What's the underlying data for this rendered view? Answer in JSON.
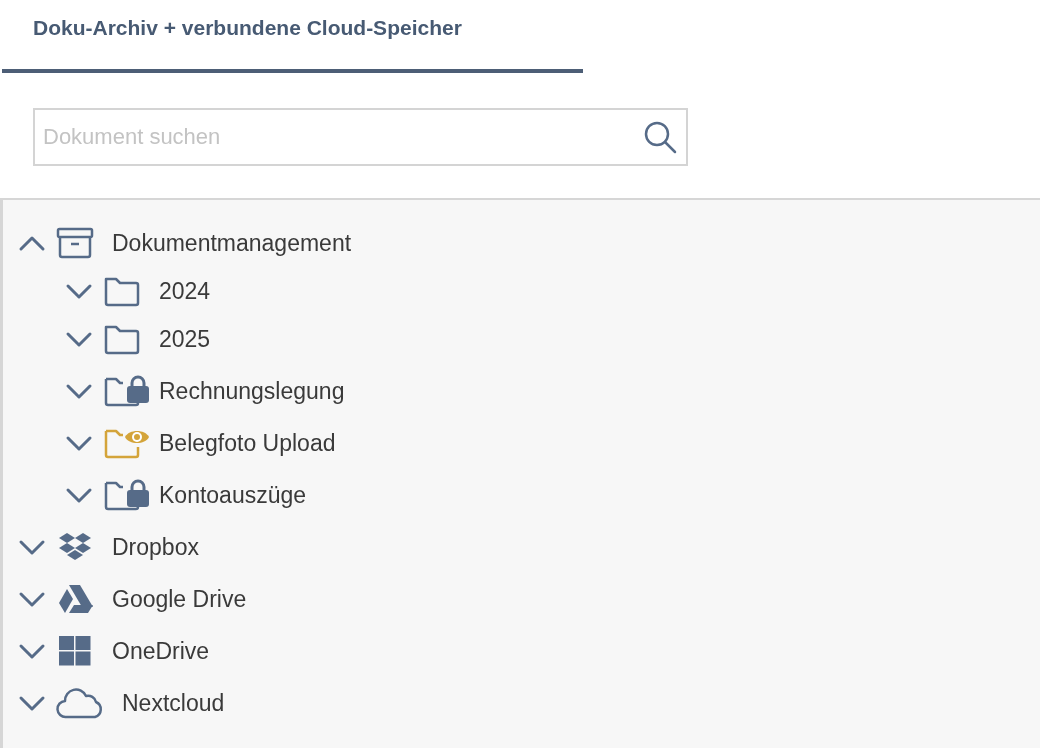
{
  "tab": {
    "label": "Doku-Archiv + verbundene Cloud-Speicher",
    "selected": true
  },
  "search": {
    "placeholder": "Dokument suchen"
  },
  "tree": [
    {
      "label": "Dokumentmanagement",
      "kind": "archive",
      "expanded": true,
      "children": [
        {
          "label": "2024",
          "kind": "folder",
          "expanded": false
        },
        {
          "label": "2025",
          "kind": "folder",
          "expanded": false
        },
        {
          "label": "Rechnungslegung",
          "kind": "locked-folder",
          "expanded": false
        },
        {
          "label": "Belegfoto Upload",
          "kind": "watched-folder",
          "expanded": false
        },
        {
          "label": "Kontoauszüge",
          "kind": "locked-folder",
          "expanded": false
        }
      ]
    },
    {
      "label": "Dropbox",
      "kind": "dropbox",
      "expanded": false
    },
    {
      "label": "Google Drive",
      "kind": "drive",
      "expanded": false
    },
    {
      "label": "OneDrive",
      "kind": "windows",
      "expanded": false
    },
    {
      "label": "Nextcloud",
      "kind": "cloud",
      "expanded": false
    }
  ]
}
